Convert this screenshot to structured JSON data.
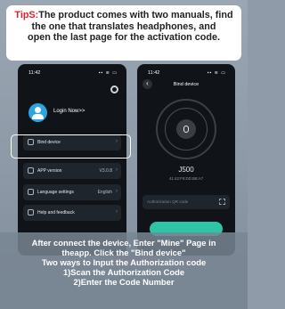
{
  "tips": {
    "label": "TipS:",
    "text_line1": "The product comes with two manuals, find",
    "text_line2": "the one that translates headphones, and",
    "text_line3": "open the last page for the activation code."
  },
  "left_phone": {
    "time": "11:42",
    "status_icons": "▪▪ ≋ ▭",
    "login": "Login Now>>",
    "menu": [
      {
        "label": "Bind device",
        "value": ""
      },
      {
        "label": "APP version",
        "value": "V3.0.8"
      },
      {
        "label": "Language settings",
        "value": "English"
      },
      {
        "label": "Help and feedback",
        "value": ""
      }
    ]
  },
  "right_phone": {
    "time": "11:42",
    "status_icons": "▪▪ ≋ ▭",
    "title": "Bind device",
    "model": "J500",
    "mac": "41:42:F9:DD:B8:A7",
    "auth_placeholder": "Authorization QR code"
  },
  "instructions": [
    "After connect the device, Enter \"Mine\" Page in",
    "theapp. Click the \"Bind device\"",
    "Two ways to Input the Authorization code",
    "1)Scan the Authorization Code",
    "2)Enter the Code Number"
  ],
  "colors": {
    "tips_label": "#e0202a",
    "accent": "#2ec4a6",
    "avatar": "#2aa5e0"
  }
}
